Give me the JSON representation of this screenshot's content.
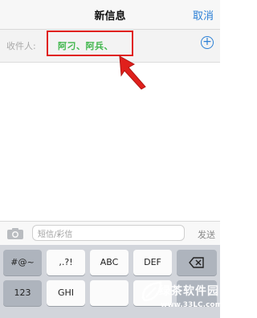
{
  "nav": {
    "title": "新信息",
    "cancel_label": "取消"
  },
  "recipients_row": {
    "label": "收件人:",
    "value": "阿刁、阿兵、",
    "add_icon": "plus-circle-icon"
  },
  "compose": {
    "camera_icon": "camera-icon",
    "placeholder": "短信/彩信",
    "send_label": "发送"
  },
  "keyboard": {
    "row1": [
      "#@~",
      ",.?!",
      "ABC",
      "DEF"
    ],
    "row1_delete_icon": "backspace-icon",
    "row2": [
      "123",
      "GHI"
    ]
  },
  "watermark": {
    "brand": "绿茶软件园",
    "url": "www.33LC.com"
  },
  "colors": {
    "accent": "#2a7fd6",
    "recipient_text": "#3fb64b",
    "annotation": "#e0201c"
  }
}
